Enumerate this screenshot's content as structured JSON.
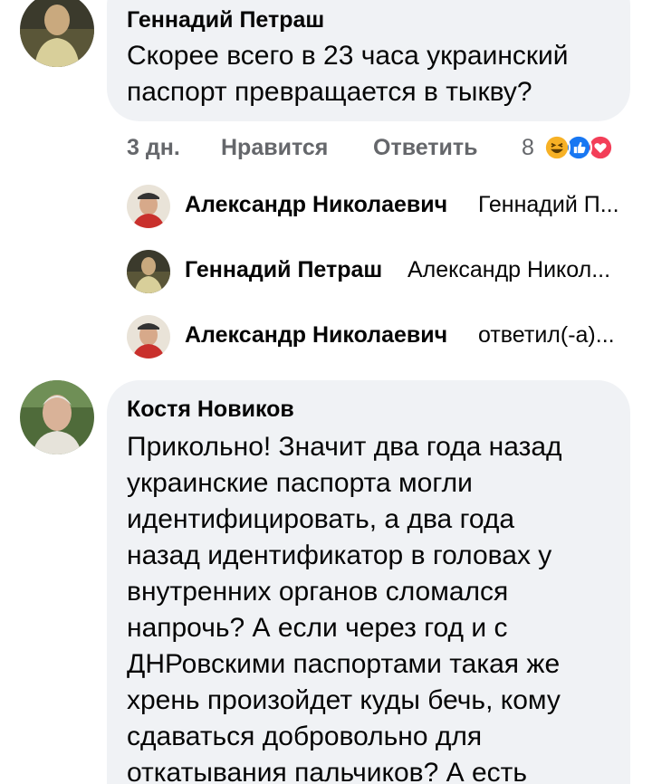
{
  "comment1": {
    "author": "Геннадий Петраш",
    "lines": [
      "Скорее всего в 23 часа украинский",
      "паспорт превращается в тыкву?"
    ],
    "time": "3 дн.",
    "like_label": "Нравится",
    "reply_label": "Ответить",
    "reaction_count": "8",
    "reactions": [
      "haha-icon",
      "like-icon",
      "love-icon"
    ]
  },
  "replies": [
    {
      "author": "Александр Николаевич",
      "snippet": "Геннадий П..."
    },
    {
      "author": "Геннадий Петраш",
      "snippet": "Александр Никол..."
    },
    {
      "author": "Александр Николаевич",
      "snippet": "ответил(-а)..."
    }
  ],
  "comment2": {
    "author": "Костя Новиков",
    "lines": [
      "Прикольно! Значит два года назад",
      "украинские паспорта могли",
      "идентифицировать, а два года",
      "назад идентификатор в головах у",
      "внутренних органов сломался",
      "напрочь? А если через год и с",
      "ДНРовскими паспортами такая же",
      "хрень произойдет куды бечь, кому",
      "сдаваться добровольно для",
      "откатывания пальчиков? А есть"
    ]
  },
  "colors": {
    "bubble": "#f0f2f5",
    "meta_gray": "#65676b",
    "like_blue": "#1877f2",
    "love_red": "#f33e58",
    "haha_yellow": "#f7b125"
  }
}
